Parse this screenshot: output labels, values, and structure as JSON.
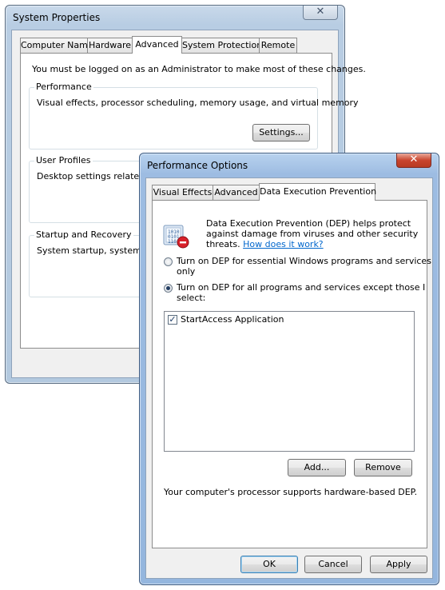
{
  "system_properties": {
    "title": "System Properties",
    "close_glyph": "✕",
    "tabs": [
      {
        "label": "Computer Name"
      },
      {
        "label": "Hardware"
      },
      {
        "label": "Advanced"
      },
      {
        "label": "System Protection"
      },
      {
        "label": "Remote"
      }
    ],
    "admin_note": "You must be logged on as an Administrator to make most of these changes.",
    "performance": {
      "legend": "Performance",
      "description": "Visual effects, processor scheduling, memory usage, and virtual memory",
      "settings_label": "Settings..."
    },
    "user_profiles": {
      "legend": "User Profiles",
      "description": "Desktop settings related to"
    },
    "startup_recovery": {
      "legend": "Startup and Recovery",
      "description": "System startup, system failu"
    }
  },
  "performance_options": {
    "title": "Performance Options",
    "close_glyph": "✕",
    "tabs": [
      {
        "label": "Visual Effects"
      },
      {
        "label": "Advanced"
      },
      {
        "label": "Data Execution Prevention"
      }
    ],
    "icon": "dep-shield-icon",
    "intro_line1": "Data Execution Prevention (DEP) helps protect",
    "intro_line2": "against damage from viruses and other security",
    "intro_line3": "threats.",
    "how_link": "How does it work?",
    "radio_essential": {
      "line1": "Turn on DEP for essential Windows programs and services",
      "line2": "only",
      "checked": false
    },
    "radio_all": {
      "line1": "Turn on DEP for all programs and services except those I",
      "line2": "select:",
      "checked": true
    },
    "programs": [
      {
        "label": "StartAccess Application",
        "checked": true
      }
    ],
    "add_label": "Add...",
    "remove_label": "Remove",
    "hardware_note": "Your computer's processor supports hardware-based DEP.",
    "ok_label": "OK",
    "cancel_label": "Cancel",
    "apply_label": "Apply"
  }
}
